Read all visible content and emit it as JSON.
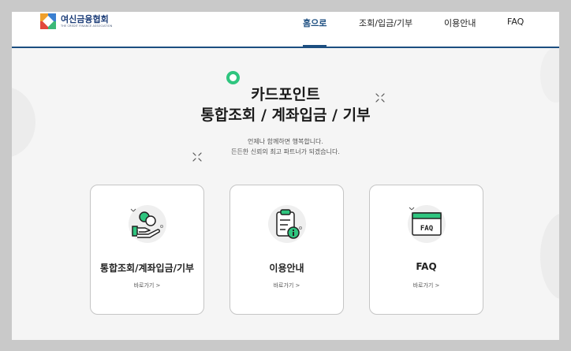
{
  "header": {
    "logo_name": "여신금융협회",
    "logo_sub": "THE CREDIT FINANCE ASSOCIATION",
    "nav": [
      {
        "label": "홈으로",
        "active": true
      },
      {
        "label": "조회/입금/기부",
        "active": false
      },
      {
        "label": "이용안내",
        "active": false
      },
      {
        "label": "FAQ",
        "active": false
      }
    ]
  },
  "hero": {
    "title_line1": "카드포인트",
    "title_line2": "통합조회 / 계좌입금 / 기부",
    "sub_line1": "언제나 함께하면 행복합니다.",
    "sub_line2": "든든한 신뢰의 최고 파트너가 되겠습니다."
  },
  "cards": [
    {
      "title": "통합조회/계좌입금/기부",
      "link": "바로가기 >",
      "icon": "coin-hand-icon"
    },
    {
      "title": "이용안내",
      "link": "바로가기 >",
      "icon": "clipboard-info-icon"
    },
    {
      "title": "FAQ",
      "link": "바로가기 >",
      "icon": "faq-window-icon"
    }
  ],
  "colors": {
    "brand": "#1c4e80",
    "accent_green": "#2fc57f",
    "background": "#f5f5f5"
  }
}
